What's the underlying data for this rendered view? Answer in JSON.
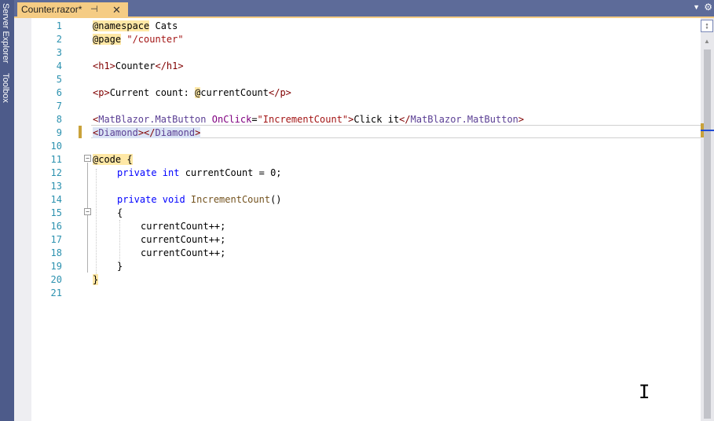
{
  "sidebar": {
    "server_explorer": "Server Explorer",
    "toolbox": "Toolbox"
  },
  "tab": {
    "title": "Counter.razor*",
    "pin_icon": "pin-icon",
    "close_icon": "close-icon"
  },
  "editor": {
    "current_line": 9,
    "lines": [
      {
        "n": "1"
      },
      {
        "n": "2"
      },
      {
        "n": "3"
      },
      {
        "n": "4"
      },
      {
        "n": "5"
      },
      {
        "n": "6"
      },
      {
        "n": "7"
      },
      {
        "n": "8"
      },
      {
        "n": "9"
      },
      {
        "n": "10"
      },
      {
        "n": "11"
      },
      {
        "n": "12"
      },
      {
        "n": "13"
      },
      {
        "n": "14"
      },
      {
        "n": "15"
      },
      {
        "n": "16"
      },
      {
        "n": "17"
      },
      {
        "n": "18"
      },
      {
        "n": "19"
      },
      {
        "n": "20"
      },
      {
        "n": "21"
      }
    ],
    "code": {
      "l1_dir": "@namespace",
      "l1_rest": " Cats",
      "l2_dir": "@page",
      "l2_str": " \"/counter\"",
      "l4_open": "<h1>",
      "l4_text": "Counter",
      "l4_close": "</h1>",
      "l6_open": "<p>",
      "l6_text": "Current count: ",
      "l6_at": "@",
      "l6_var": "currentCount",
      "l6_close": "</p>",
      "l8_lt": "<",
      "l8_comp": "MatBlazor.MatButton",
      "l8_attr": " OnClick",
      "l8_eq": "=",
      "l8_val": "\"IncrementCount\"",
      "l8_gt": ">",
      "l8_text": "Click it",
      "l8_close_lt": "</",
      "l8_close_comp": "MatBlazor.MatButton",
      "l8_close_gt": ">",
      "l9_open_lt": "<",
      "l9_open_comp": "Diamond",
      "l9_open_gt": ">",
      "l9_close_lt": "</",
      "l9_close_comp": "Diamond",
      "l9_close_gt": ">",
      "l11_dir": "@code",
      "l11_brace": " {",
      "l12_kw": "private int",
      "l12_rest": " currentCount = 0;",
      "l14_kw": "private void",
      "l14_meth": " IncrementCount",
      "l14_rest": "()",
      "l15": "{",
      "l16": "currentCount++;",
      "l17": "currentCount++;",
      "l18": "currentCount++;",
      "l19": "}",
      "l20": "}"
    }
  },
  "scrollbar": {
    "split_icon": "split-view-icon"
  },
  "colors": {
    "chrome": "#5d6b99",
    "tab_active": "#f5cc84",
    "line_number": "#2b91af",
    "keyword": "#0000ff",
    "string": "#a31515"
  }
}
